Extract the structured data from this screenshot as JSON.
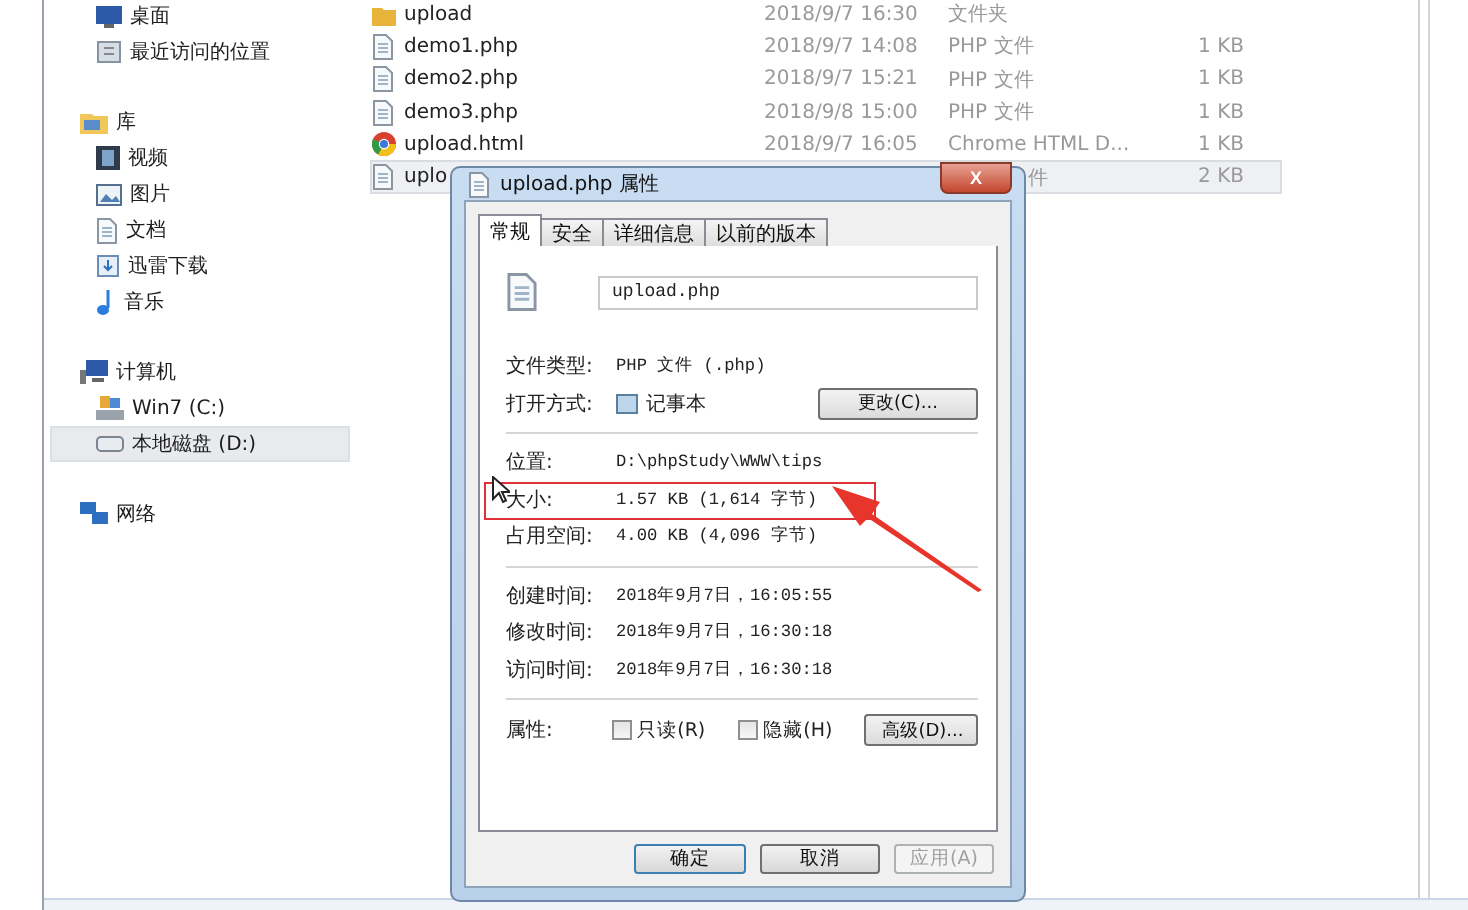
{
  "sidebar": {
    "groups": [
      {
        "items": [
          {
            "label": "桌面",
            "kind": "desktop",
            "selected": false
          },
          {
            "label": "最近访问的位置",
            "kind": "recent",
            "selected": false
          }
        ]
      },
      {
        "label": "库",
        "kind": "library",
        "items": [
          {
            "label": "视频",
            "kind": "video",
            "selected": false
          },
          {
            "label": "图片",
            "kind": "picture",
            "selected": false
          },
          {
            "label": "文档",
            "kind": "document",
            "selected": false
          },
          {
            "label": "迅雷下载",
            "kind": "download",
            "selected": false
          },
          {
            "label": "音乐",
            "kind": "music",
            "selected": false
          }
        ]
      },
      {
        "label": "计算机",
        "kind": "computer",
        "items": [
          {
            "label": "Win7 (C:)",
            "kind": "system",
            "selected": false
          },
          {
            "label": "本地磁盘 (D:)",
            "kind": "drive",
            "selected": true
          }
        ]
      },
      {
        "label": "网络",
        "kind": "network"
      }
    ]
  },
  "files": [
    {
      "name": "upload",
      "date": "2018/9/7 16:30",
      "type": "文件夹",
      "kind": "folder",
      "selected": false,
      "covered": false
    },
    {
      "name": "demo1.php",
      "date": "2018/9/7 14:08",
      "type": "PHP 文件",
      "size": "1 KB",
      "kind": "file",
      "selected": false,
      "covered": false
    },
    {
      "name": "demo2.php",
      "date": "2018/9/7 15:21",
      "type": "PHP 文件",
      "size": "1 KB",
      "kind": "file",
      "selected": false,
      "covered": false
    },
    {
      "name": "demo3.php",
      "date": "2018/9/8 15:00",
      "type": "PHP 文件",
      "size": "1 KB",
      "kind": "file",
      "selected": false,
      "covered": false
    },
    {
      "name": "upload.html",
      "date": "2018/9/7 16:05",
      "type": "Chrome HTML D...",
      "size": "1 KB",
      "kind": "browser",
      "selected": false,
      "covered": false
    },
    {
      "name": "uplo",
      "type": "件",
      "size": "2 KB",
      "kind": "file",
      "selected": true,
      "covered": true
    }
  ],
  "dialog": {
    "title": "upload.php 属性",
    "close": "X",
    "tabs": [
      {
        "label": "常规",
        "selected": true
      },
      {
        "label": "安全",
        "selected": false
      },
      {
        "label": "详细信息",
        "selected": false
      },
      {
        "label": "以前的版本",
        "selected": false
      }
    ],
    "file_name": "upload.php",
    "sections": [
      [
        {
          "label": "文件类型:",
          "value": "PHP 文件 (.php)"
        },
        {
          "label": "打开方式:",
          "value": "记事本",
          "button": "更改(C)..."
        }
      ],
      [
        {
          "label": "位置:",
          "value": "D:\\phpStudy\\WWW\\tips"
        },
        {
          "label": "大小:",
          "value": "1.57 KB (1,614 字节)",
          "highlighted": true
        },
        {
          "label": "占用空间:",
          "value": "4.00 KB (4,096 字节)"
        }
      ],
      [
        {
          "label": "创建时间:",
          "value": "2018年9月7日，16:05:55"
        },
        {
          "label": "修改时间:",
          "value": "2018年9月7日，16:30:18"
        },
        {
          "label": "访问时间:",
          "value": "2018年9月7日，16:30:18"
        }
      ]
    ],
    "attributes_label": "属性:",
    "attributes": [
      {
        "label": "只读(R)",
        "checked": false
      },
      {
        "label": "隐藏(H)",
        "checked": false
      }
    ],
    "advanced_button": "高级(D)...",
    "buttons": [
      {
        "label": "确定",
        "disabled": false
      },
      {
        "label": "取消",
        "disabled": false
      },
      {
        "label": "应用(A)",
        "disabled": true
      }
    ]
  }
}
